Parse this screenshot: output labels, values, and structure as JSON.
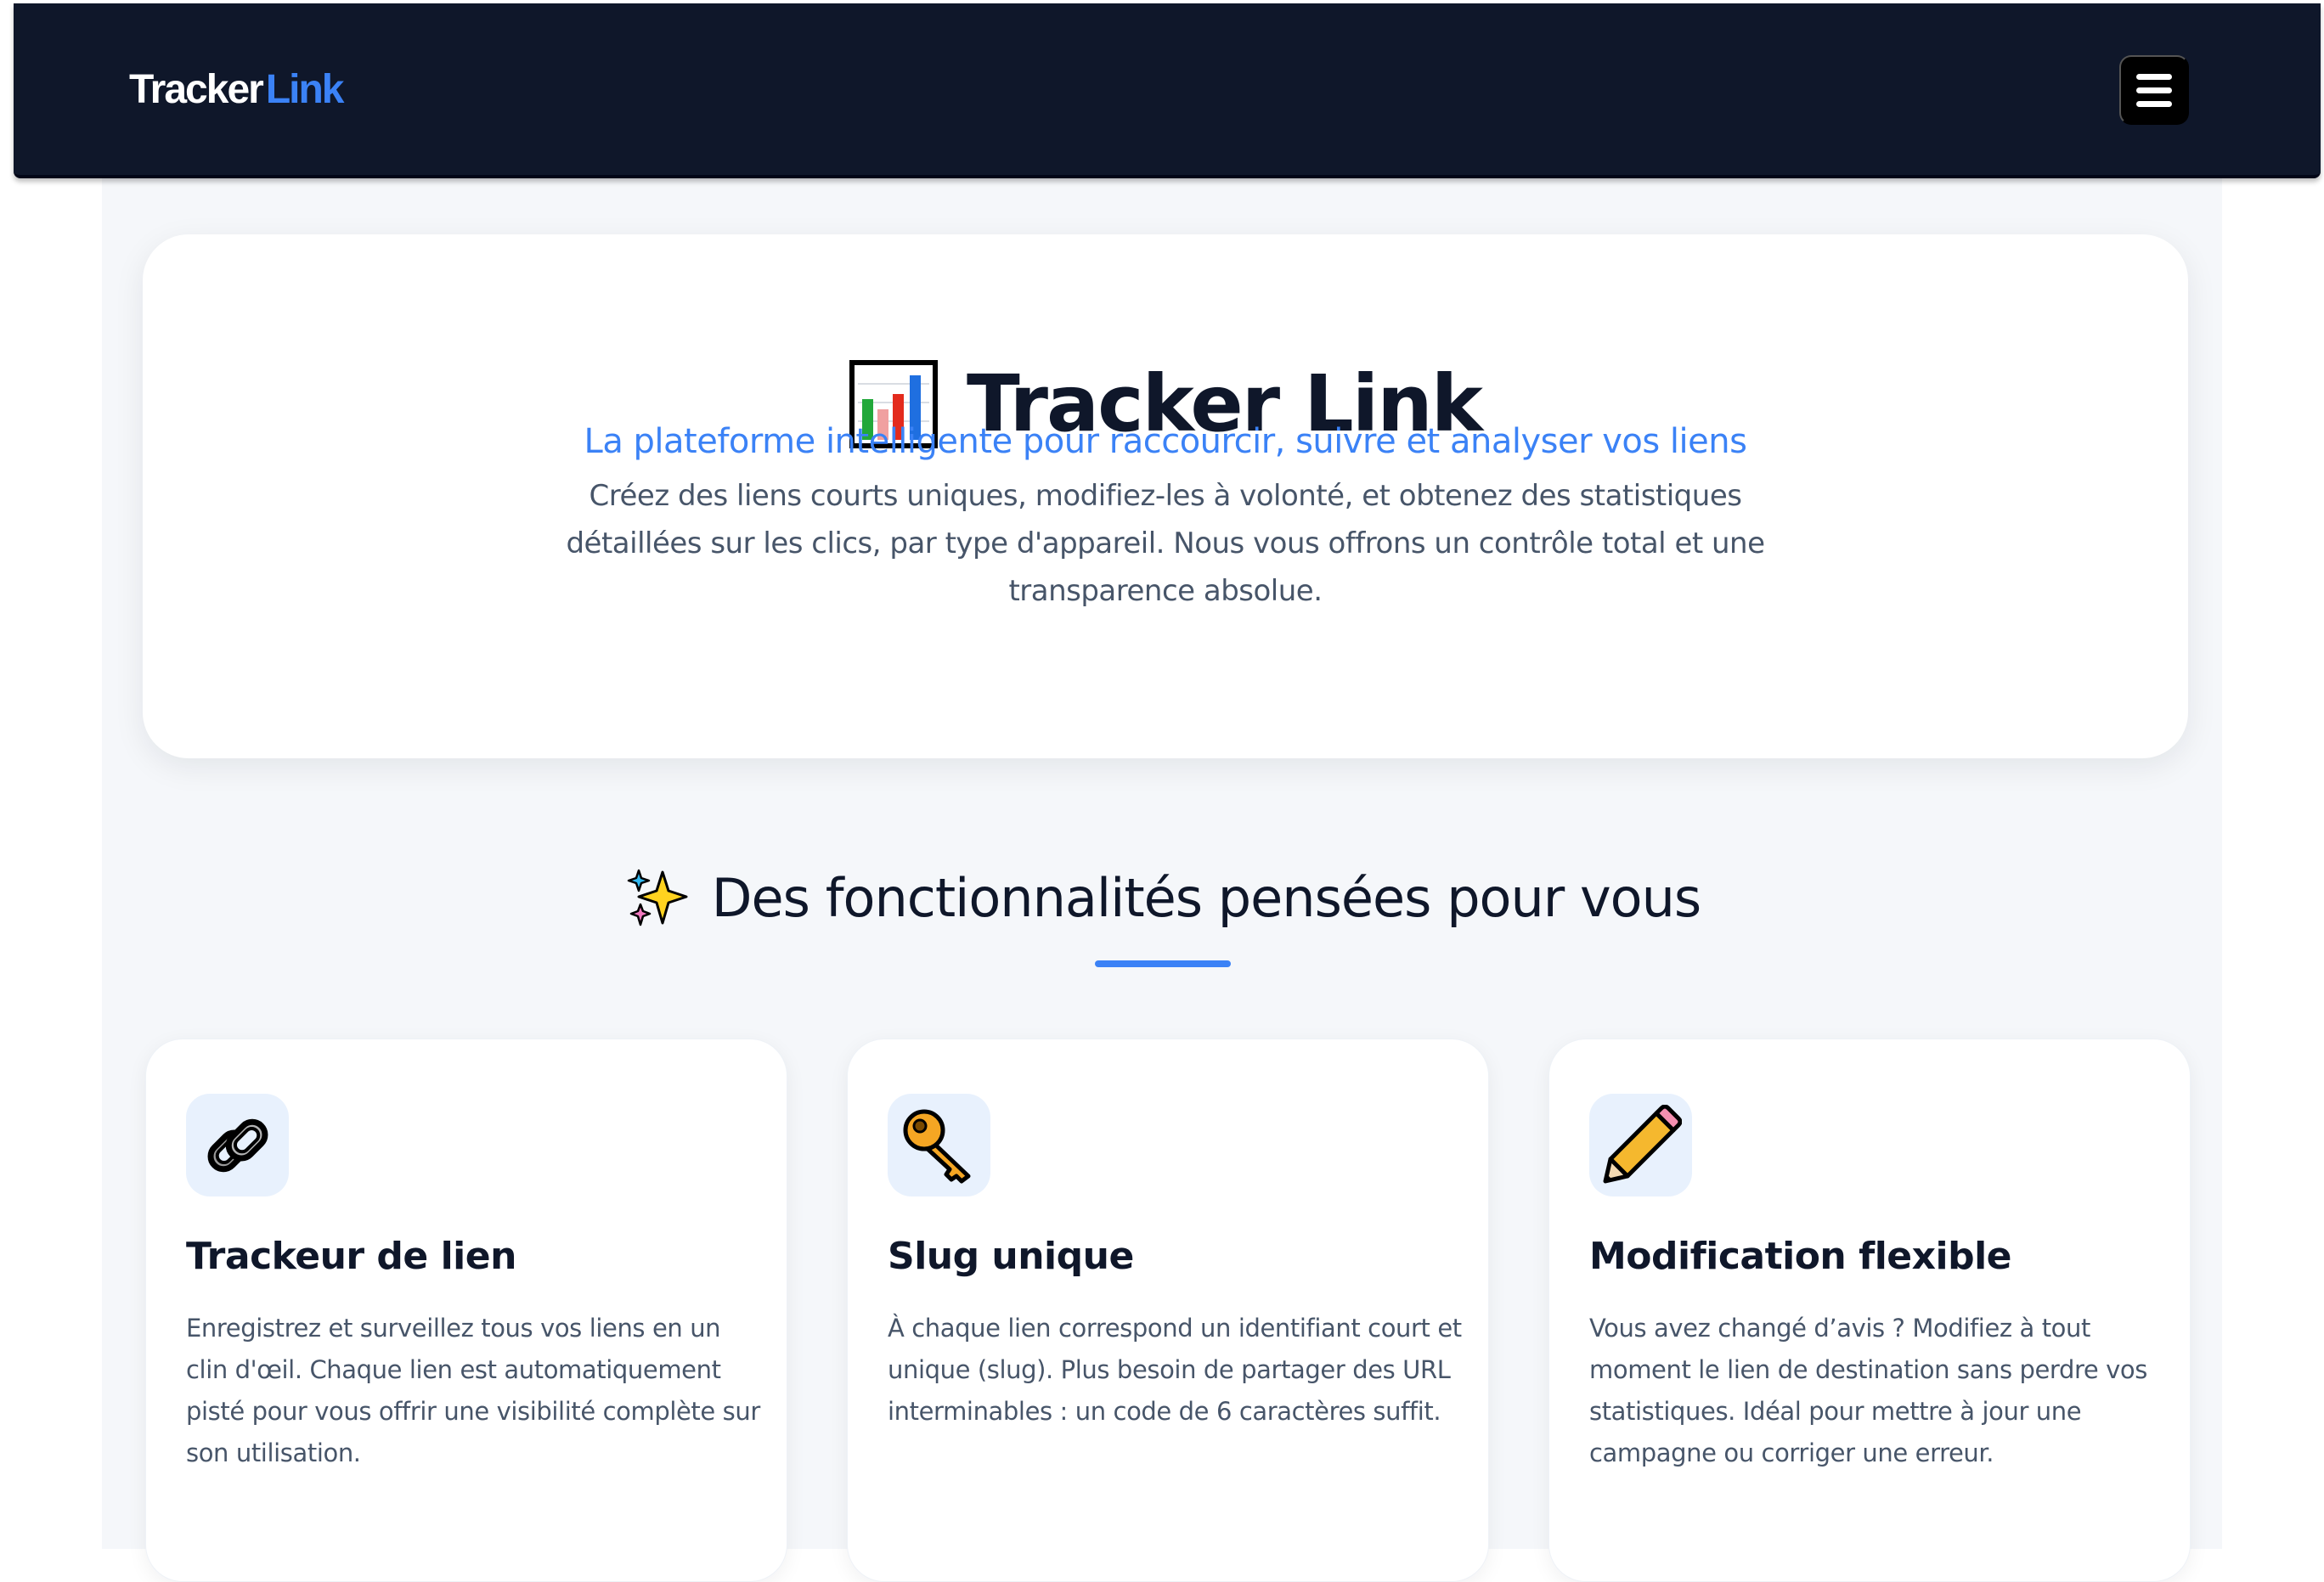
{
  "nav": {
    "brand_main": "Tracker",
    "brand_accent": "Link",
    "menu_icon": "hamburger-menu-icon"
  },
  "hero": {
    "icon": "bar-chart-icon",
    "title": "Tracker Link",
    "subtitle": "La plateforme intelligente pour raccourcir, suivre et analyser vos liens",
    "description": "Créez des liens courts uniques, modifiez-les à volonté, et obtenez des statistiques détaillées sur les clics, par type d'appareil. Nous vous offrons un contrôle total et une transparence absolue."
  },
  "features": {
    "icon": "sparkles-icon",
    "heading": "Des fonctionnalités pensées pour vous",
    "items": [
      {
        "icon": "link-icon",
        "title": "Trackeur de lien",
        "text": "Enregistrez et surveillez tous vos liens en un clin d'œil. Chaque lien est automatiquement pisté pour vous offrir une visibilité complète sur son utilisation."
      },
      {
        "icon": "key-icon",
        "title": "Slug unique",
        "text": "À chaque lien correspond un identifiant court et unique (slug). Plus besoin de partager des URL interminables : un code de 6 caractères suffit."
      },
      {
        "icon": "pencil-icon",
        "title": "Modification flexible",
        "text": "Vous avez changé d’avis ? Modifiez à tout moment le lien de destination sans perdre vos statistiques. Idéal pour mettre à jour une campagne ou corriger une erreur."
      }
    ]
  },
  "colors": {
    "navbar": "#0f172a",
    "accent": "#3b82f6",
    "page_background": "#f5f7fa",
    "text_dark": "#0f172a",
    "text_muted": "#475569"
  }
}
